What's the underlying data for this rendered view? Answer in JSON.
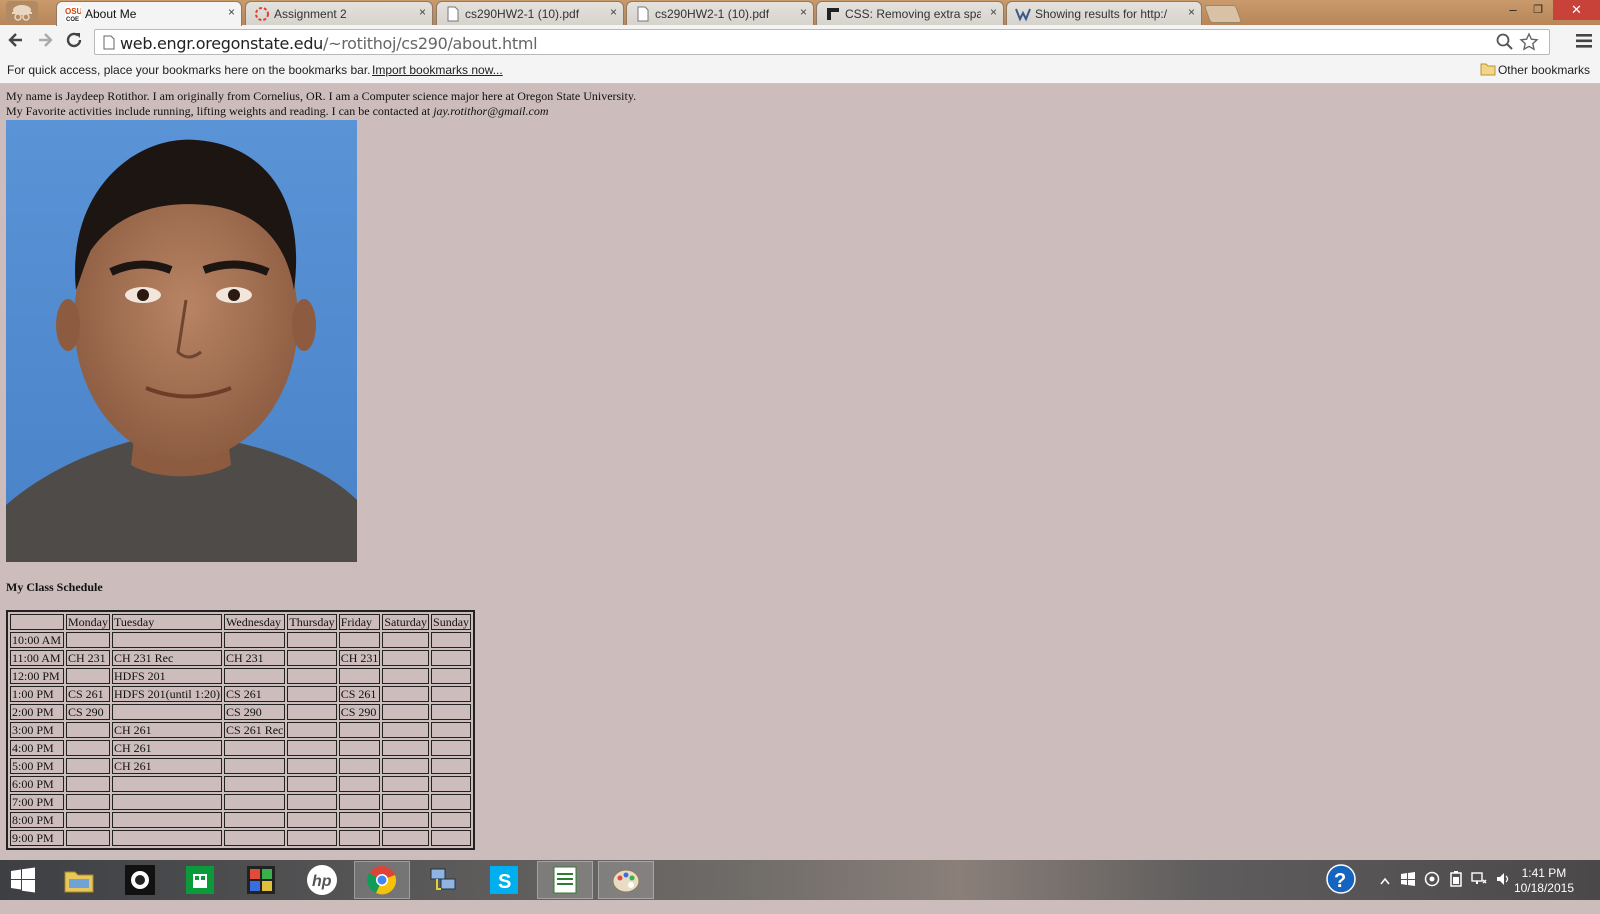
{
  "browser": {
    "tabs": [
      {
        "label": "About Me",
        "favicon": "osu-coe-icon",
        "active": true
      },
      {
        "label": "Assignment 2",
        "favicon": "canvas-icon",
        "active": false
      },
      {
        "label": "cs290HW2-1 (10).pdf",
        "favicon": "document-icon",
        "active": false
      },
      {
        "label": "cs290HW2-1 (10).pdf",
        "favicon": "document-icon",
        "active": false
      },
      {
        "label": "CSS: Removing extra spac",
        "favicon": "stackoverflow-icon",
        "active": false
      },
      {
        "label": "Showing results for http:/",
        "favicon": "validator-icon",
        "active": false
      }
    ],
    "close_glyph": "×",
    "window_buttons": {
      "minimize": "–",
      "restore": "❐",
      "close": "✕"
    },
    "url_domain": "web.engr.oregonstate.edu",
    "url_path": "/~rotithoj/cs290/about.html",
    "bookmarks_hint": "For quick access, place your bookmarks here on the bookmarks bar.",
    "import_link": "Import bookmarks now...",
    "other_bookmarks": "Other bookmarks"
  },
  "page": {
    "intro_line1": "My name is Jaydeep Rotithor. I am originally from Cornelius, OR. I am a Computer science major here at Oregon State University.",
    "intro_line2": "My Favorite activities include running, lifting weights and reading. I can be contacted at",
    "email": "jay.rotithor@gmail.com",
    "schedule_heading": "My Class Schedule",
    "schedule": {
      "headers": [
        "",
        "Monday",
        "Tuesday",
        "Wednesday",
        "Thursday",
        "Friday",
        "Saturday",
        "Sunday"
      ],
      "rows": [
        [
          "10:00 AM",
          "",
          "",
          "",
          "",
          "",
          "",
          ""
        ],
        [
          "11:00 AM",
          "CH 231",
          "CH 231 Rec",
          "CH 231",
          "",
          "CH 231",
          "",
          ""
        ],
        [
          "12:00 PM",
          "",
          "HDFS 201",
          "",
          "",
          "",
          "",
          ""
        ],
        [
          "1:00 PM",
          "CS 261",
          "HDFS 201(until 1:20)",
          "CS 261",
          "",
          "CS 261",
          "",
          ""
        ],
        [
          "2:00 PM",
          "CS 290",
          "",
          "CS 290",
          "",
          "CS 290",
          "",
          ""
        ],
        [
          "3:00 PM",
          "",
          "CH 261",
          "CS 261 Rec",
          "",
          "",
          "",
          ""
        ],
        [
          "4:00 PM",
          "",
          "CH 261",
          "",
          "",
          "",
          "",
          ""
        ],
        [
          "5:00 PM",
          "",
          "CH 261",
          "",
          "",
          "",
          "",
          ""
        ],
        [
          "6:00 PM",
          "",
          "",
          "",
          "",
          "",
          "",
          ""
        ],
        [
          "7:00 PM",
          "",
          "",
          "",
          "",
          "",
          "",
          ""
        ],
        [
          "8:00 PM",
          "",
          "",
          "",
          "",
          "",
          "",
          ""
        ],
        [
          "9:00 PM",
          "",
          "",
          "",
          "",
          "",
          "",
          ""
        ]
      ]
    }
  },
  "taskbar": {
    "apps": [
      "windows-start-icon",
      "file-explorer-icon",
      "camera-app-icon",
      "store-icon",
      "photos-app-icon",
      "hp-icon",
      "chrome-icon",
      "network-app-icon",
      "skype-icon",
      "spreadsheet-icon",
      "paint-icon"
    ],
    "time": "1:41 PM",
    "date": "10/18/2015"
  },
  "colors": {
    "page_background": "#cdbcbc",
    "tabstrip": "#c99a6c",
    "tray_close": "#c8423a"
  }
}
